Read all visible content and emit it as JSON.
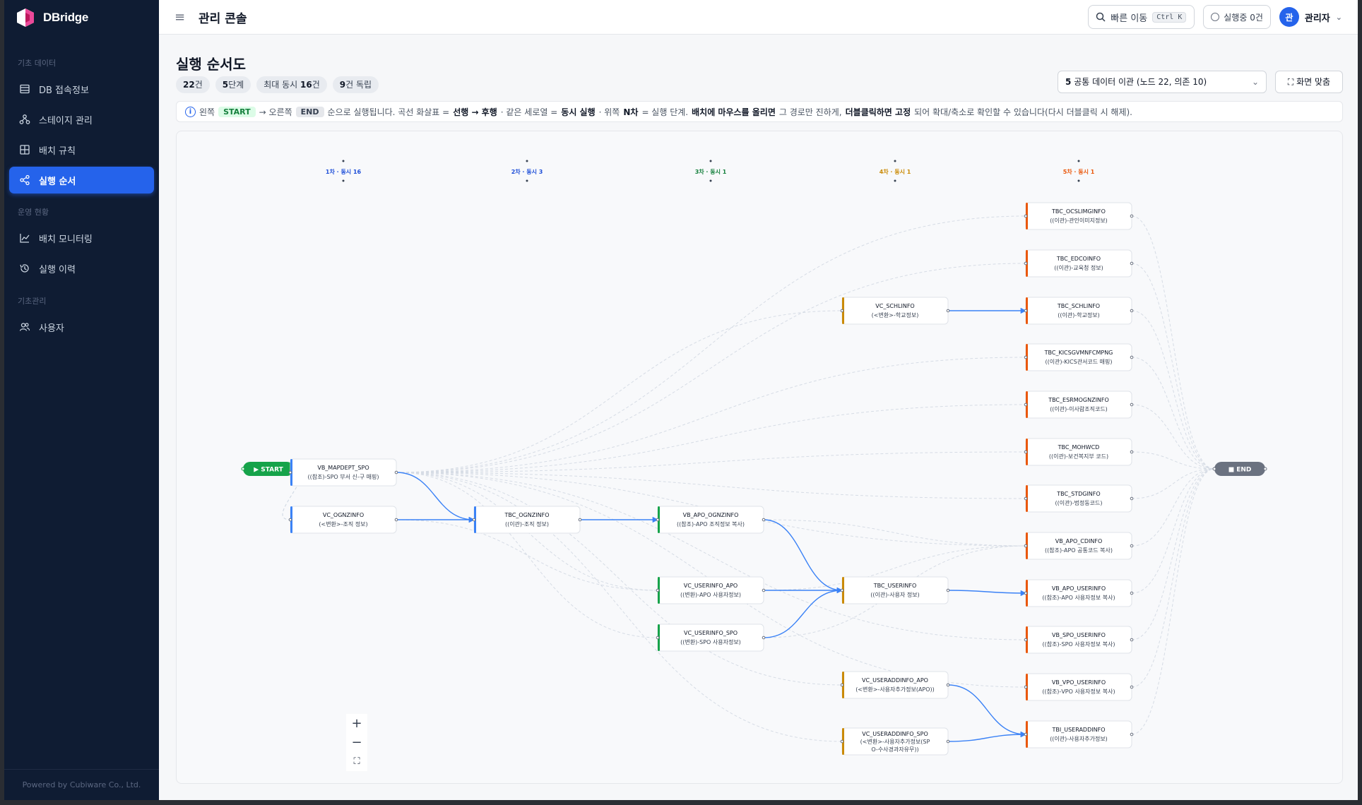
{
  "brand": {
    "name": "DBridge"
  },
  "sidebar": {
    "sections": [
      "기초 데이터",
      "운영 현황",
      "기초관리"
    ],
    "items": [
      {
        "label": "DB 접속정보",
        "icon": "database-icon"
      },
      {
        "label": "스테이지 관리",
        "icon": "stage-icon"
      },
      {
        "label": "배치 규칙",
        "icon": "grid-icon"
      },
      {
        "label": "실행 순서",
        "icon": "share-icon",
        "active": true
      },
      {
        "label": "배치 모니터링",
        "icon": "chart-line-icon"
      },
      {
        "label": "실행 이력",
        "icon": "history-icon"
      },
      {
        "label": "사용자",
        "icon": "users-icon"
      }
    ],
    "footer": "Powered by Cubiware Co., Ltd."
  },
  "topbar": {
    "title": "관리 콘솔",
    "quick_move": "빠른 이동",
    "shortcut": "Ctrl K",
    "running": "실행중 0건",
    "user_initial": "관",
    "user_name": "관리자"
  },
  "page": {
    "title": "실행 순서도",
    "chips": [
      {
        "num": "22",
        "text": "건"
      },
      {
        "num": "5",
        "text": "단계"
      },
      {
        "num": "16",
        "text": "건",
        "prefix": "최대 동시 "
      },
      {
        "num": "9",
        "text": "건 독립"
      }
    ],
    "group_select": {
      "num": "5",
      "label": "공통 데이터 이관 (노드 22, 의존 10)"
    },
    "fit_button": "화면 맞춤"
  },
  "info": {
    "t1": "왼쪽",
    "start_tag": "START",
    "t2": "→ 오른쪽",
    "end_tag": "END",
    "t3": "순으로 실행됩니다. 곡선 화살표 =",
    "b1": "선행 → 후행",
    "t4": "· 같은 세로열 =",
    "b2": "동시 실행",
    "t5": "· 위쪽",
    "b3": "N차",
    "t6": "= 실행 단계.",
    "b4": "배치에 마우스를 올리면",
    "t7": "그 경로만 진하게,",
    "b5": "더블클릭하면 고정",
    "t8": "되어 확대/축소로 확인할 수 있습니다(다시 더블클릭 시 해제)."
  },
  "graph": {
    "stages": [
      {
        "label": "1차 · 동시 16",
        "color": "#1d4ed8"
      },
      {
        "label": "2차 · 동시 3",
        "color": "#1d4ed8"
      },
      {
        "label": "3차 · 동시 1",
        "color": "#15803d"
      },
      {
        "label": "4차 · 동시 1",
        "color": "#ca8a04"
      },
      {
        "label": "5차 · 동시 1",
        "color": "#ea580c"
      }
    ],
    "start_label": "▶ START",
    "end_label": "■ END",
    "nodes": [
      {
        "id": "n1",
        "name": "VB_MAPDEPT_SPO",
        "desc": "((참조)-SPO 부서 신-구 매핑)"
      },
      {
        "id": "n2",
        "name": "VC_OGNZINFO",
        "desc": "(<변환>-조직 정보)"
      },
      {
        "id": "n3",
        "name": "TBC_OGNZINFO",
        "desc": "((이관)-조직 정보)"
      },
      {
        "id": "n4",
        "name": "VB_APO_OGNZINFO",
        "desc": "((참조)-APO 조직정보 복사)"
      },
      {
        "id": "n5",
        "name": "VC_USERINFO_APO",
        "desc": "((변환)-APO 사용자정보)"
      },
      {
        "id": "n6",
        "name": "VC_USERINFO_SPO",
        "desc": "((변환)-SPO 사용자정보)"
      },
      {
        "id": "n7",
        "name": "VC_SCHLINFO",
        "desc": "(<변환>-학교정보)"
      },
      {
        "id": "n8",
        "name": "TBC_USERINFO",
        "desc": "((이관)-사용자 정보)"
      },
      {
        "id": "n9",
        "name": "VC_USERADDINFO_APO",
        "desc": "(<변환>-사용자추가정보(APO))"
      },
      {
        "id": "n10",
        "name": "VC_USERADDINFO_SPO",
        "desc": "(<변환>-사용자추가정보(SPO-수사경과자유무))"
      },
      {
        "id": "n11",
        "name": "TBC_OCSLIMGINFO",
        "desc": "((이관)-관인이미지정보)"
      },
      {
        "id": "n12",
        "name": "TBC_EDCOINFO",
        "desc": "((이관)-교육청 정보)"
      },
      {
        "id": "n13",
        "name": "TBC_SCHLINFO",
        "desc": "((이관)-학교정보)"
      },
      {
        "id": "n14",
        "name": "TBC_KICSGVMNFCMPNG",
        "desc": "((이관)-KICS관서코드 매핑)"
      },
      {
        "id": "n15",
        "name": "TBC_ESRMOGNZINFO",
        "desc": "((이관)-이사람조직코드)"
      },
      {
        "id": "n16",
        "name": "TBC_MOHWCD",
        "desc": "((이관)-보건복지부 코드)"
      },
      {
        "id": "n17",
        "name": "TBC_STDGINFO",
        "desc": "((이관)-법정동코드)"
      },
      {
        "id": "n18",
        "name": "VB_APO_CDINFO",
        "desc": "((참조)-APO 공통코드 복사)"
      },
      {
        "id": "n19",
        "name": "VB_APO_USERINFO",
        "desc": "((참조)-APO 사용자정보 복사)"
      },
      {
        "id": "n20",
        "name": "VB_SPO_USERINFO",
        "desc": "((참조)-SPO 사용자정보 복사)"
      },
      {
        "id": "n21",
        "name": "VB_VPO_USERINFO",
        "desc": "((참조)-VPO 사용자정보 복사)"
      },
      {
        "id": "n22",
        "name": "TBI_USERADDINFO",
        "desc": "((이관)-사용자추가정보)"
      }
    ]
  },
  "zoom": {
    "in": "+",
    "out": "−",
    "fit": "⛶"
  },
  "colors": {
    "accent": "#2563eb",
    "start": "#16a34a",
    "end": "#6b7280",
    "edge": "#3b82f6"
  }
}
